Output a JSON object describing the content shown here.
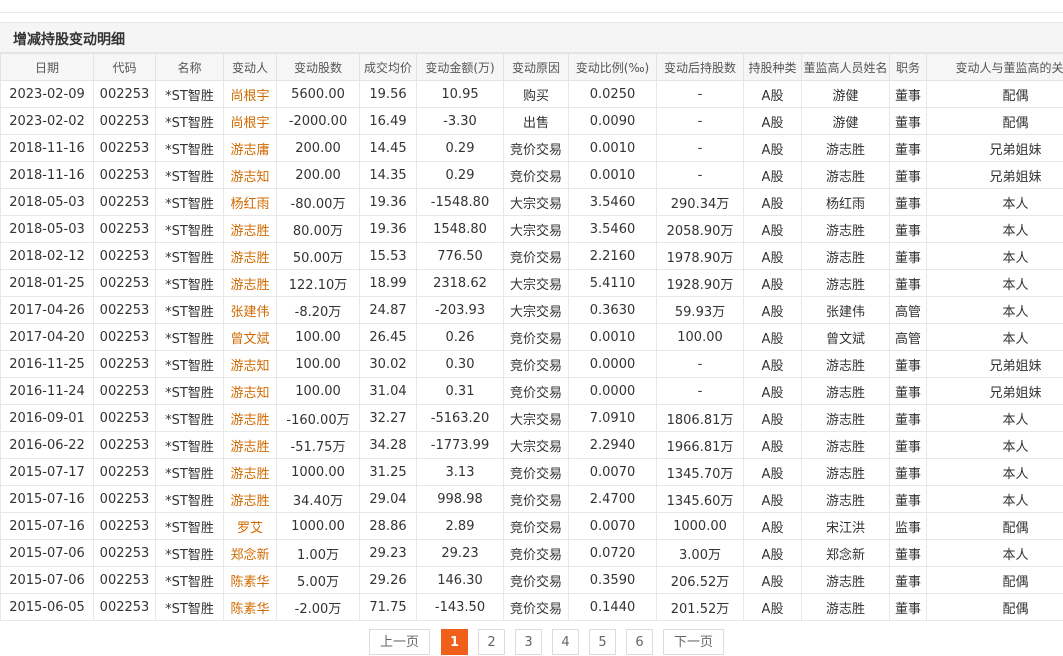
{
  "panel": {
    "title": "增减持股变动明细"
  },
  "columns": [
    "日期",
    "代码",
    "名称",
    "变动人",
    "变动股数",
    "成交均价",
    "变动金额(万)",
    "变动原因",
    "变动比例(‰)",
    "变动后持股数",
    "持股种类",
    "董监高人员姓名",
    "职务",
    "变动人与董监高的关系"
  ],
  "rows": [
    [
      "2023-02-09",
      "002253",
      "*ST智胜",
      "尚根宇",
      "5600.00",
      "19.56",
      "10.95",
      "购买",
      "0.0250",
      "-",
      "A股",
      "游健",
      "董事",
      "配偶"
    ],
    [
      "2023-02-02",
      "002253",
      "*ST智胜",
      "尚根宇",
      "-2000.00",
      "16.49",
      "-3.30",
      "出售",
      "0.0090",
      "-",
      "A股",
      "游健",
      "董事",
      "配偶"
    ],
    [
      "2018-11-16",
      "002253",
      "*ST智胜",
      "游志庸",
      "200.00",
      "14.45",
      "0.29",
      "竞价交易",
      "0.0010",
      "-",
      "A股",
      "游志胜",
      "董事",
      "兄弟姐妹"
    ],
    [
      "2018-11-16",
      "002253",
      "*ST智胜",
      "游志知",
      "200.00",
      "14.35",
      "0.29",
      "竞价交易",
      "0.0010",
      "-",
      "A股",
      "游志胜",
      "董事",
      "兄弟姐妹"
    ],
    [
      "2018-05-03",
      "002253",
      "*ST智胜",
      "杨红雨",
      "-80.00万",
      "19.36",
      "-1548.80",
      "大宗交易",
      "3.5460",
      "290.34万",
      "A股",
      "杨红雨",
      "董事",
      "本人"
    ],
    [
      "2018-05-03",
      "002253",
      "*ST智胜",
      "游志胜",
      "80.00万",
      "19.36",
      "1548.80",
      "大宗交易",
      "3.5460",
      "2058.90万",
      "A股",
      "游志胜",
      "董事",
      "本人"
    ],
    [
      "2018-02-12",
      "002253",
      "*ST智胜",
      "游志胜",
      "50.00万",
      "15.53",
      "776.50",
      "竞价交易",
      "2.2160",
      "1978.90万",
      "A股",
      "游志胜",
      "董事",
      "本人"
    ],
    [
      "2018-01-25",
      "002253",
      "*ST智胜",
      "游志胜",
      "122.10万",
      "18.99",
      "2318.62",
      "大宗交易",
      "5.4110",
      "1928.90万",
      "A股",
      "游志胜",
      "董事",
      "本人"
    ],
    [
      "2017-04-26",
      "002253",
      "*ST智胜",
      "张建伟",
      "-8.20万",
      "24.87",
      "-203.93",
      "大宗交易",
      "0.3630",
      "59.93万",
      "A股",
      "张建伟",
      "高管",
      "本人"
    ],
    [
      "2017-04-20",
      "002253",
      "*ST智胜",
      "曾文斌",
      "100.00",
      "26.45",
      "0.26",
      "竞价交易",
      "0.0010",
      "100.00",
      "A股",
      "曾文斌",
      "高管",
      "本人"
    ],
    [
      "2016-11-25",
      "002253",
      "*ST智胜",
      "游志知",
      "100.00",
      "30.02",
      "0.30",
      "竞价交易",
      "0.0000",
      "-",
      "A股",
      "游志胜",
      "董事",
      "兄弟姐妹"
    ],
    [
      "2016-11-24",
      "002253",
      "*ST智胜",
      "游志知",
      "100.00",
      "31.04",
      "0.31",
      "竞价交易",
      "0.0000",
      "-",
      "A股",
      "游志胜",
      "董事",
      "兄弟姐妹"
    ],
    [
      "2016-09-01",
      "002253",
      "*ST智胜",
      "游志胜",
      "-160.00万",
      "32.27",
      "-5163.20",
      "大宗交易",
      "7.0910",
      "1806.81万",
      "A股",
      "游志胜",
      "董事",
      "本人"
    ],
    [
      "2016-06-22",
      "002253",
      "*ST智胜",
      "游志胜",
      "-51.75万",
      "34.28",
      "-1773.99",
      "大宗交易",
      "2.2940",
      "1966.81万",
      "A股",
      "游志胜",
      "董事",
      "本人"
    ],
    [
      "2015-07-17",
      "002253",
      "*ST智胜",
      "游志胜",
      "1000.00",
      "31.25",
      "3.13",
      "竞价交易",
      "0.0070",
      "1345.70万",
      "A股",
      "游志胜",
      "董事",
      "本人"
    ],
    [
      "2015-07-16",
      "002253",
      "*ST智胜",
      "游志胜",
      "34.40万",
      "29.04",
      "998.98",
      "竞价交易",
      "2.4700",
      "1345.60万",
      "A股",
      "游志胜",
      "董事",
      "本人"
    ],
    [
      "2015-07-16",
      "002253",
      "*ST智胜",
      "罗艾",
      "1000.00",
      "28.86",
      "2.89",
      "竞价交易",
      "0.0070",
      "1000.00",
      "A股",
      "宋江洪",
      "监事",
      "配偶"
    ],
    [
      "2015-07-06",
      "002253",
      "*ST智胜",
      "郑念新",
      "1.00万",
      "29.23",
      "29.23",
      "竞价交易",
      "0.0720",
      "3.00万",
      "A股",
      "郑念新",
      "董事",
      "本人"
    ],
    [
      "2015-07-06",
      "002253",
      "*ST智胜",
      "陈素华",
      "5.00万",
      "29.26",
      "146.30",
      "竞价交易",
      "0.3590",
      "206.52万",
      "A股",
      "游志胜",
      "董事",
      "配偶"
    ],
    [
      "2015-06-05",
      "002253",
      "*ST智胜",
      "陈素华",
      "-2.00万",
      "71.75",
      "-143.50",
      "竞价交易",
      "0.1440",
      "201.52万",
      "A股",
      "游志胜",
      "董事",
      "配偶"
    ]
  ],
  "pagination": {
    "prev_label": "上一页",
    "next_label": "下一页",
    "pages": [
      "1",
      "2",
      "3",
      "4",
      "5",
      "6"
    ],
    "current": "1"
  },
  "colors": {
    "accent": "#f0601a",
    "person_link": "#d16a00"
  }
}
